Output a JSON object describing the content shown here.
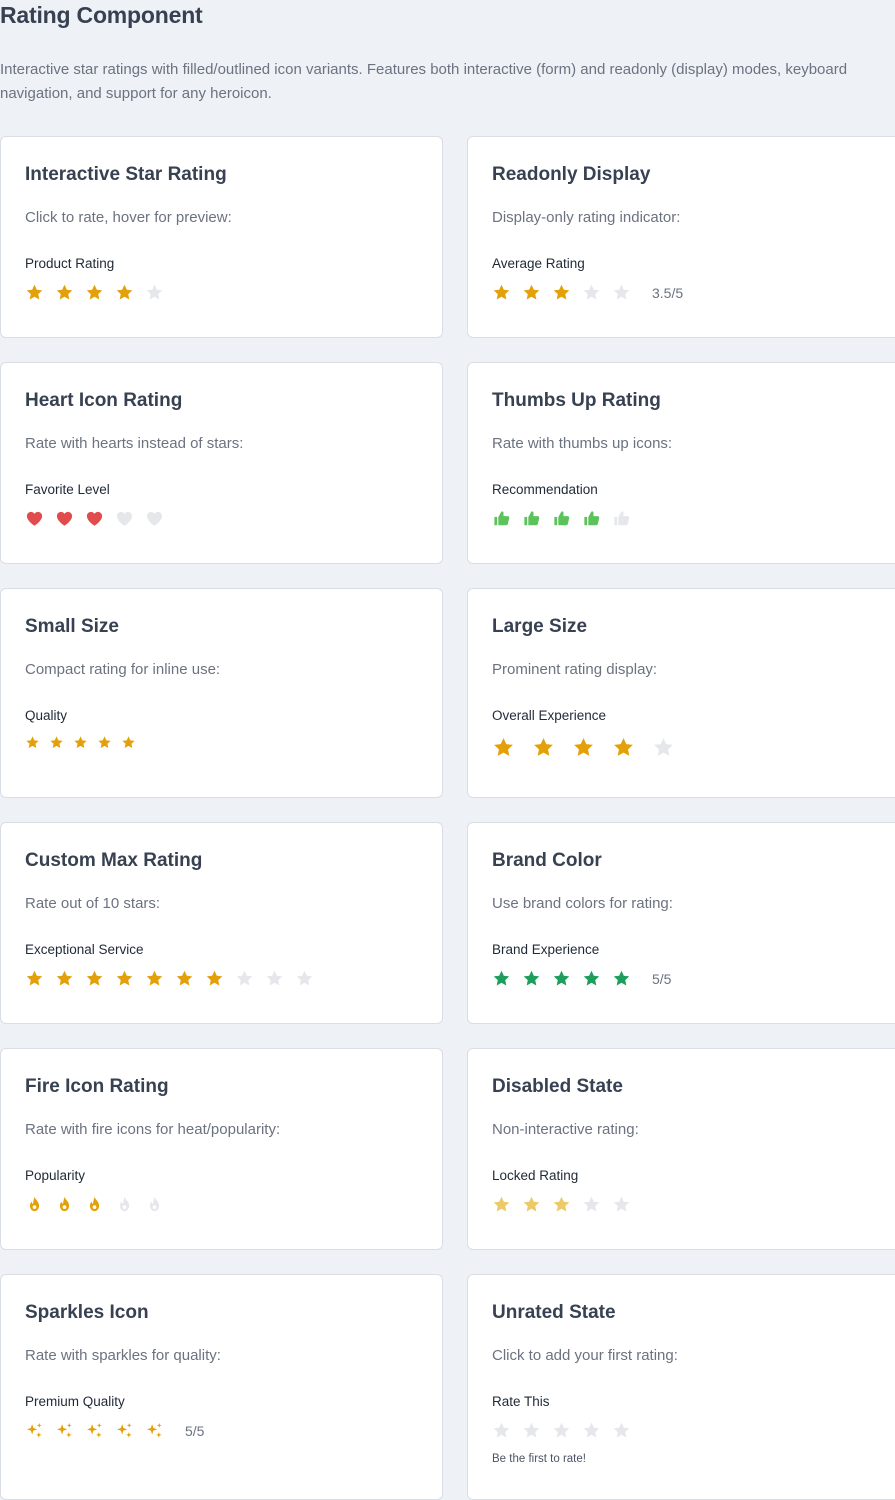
{
  "page": {
    "title": "Rating Component",
    "description": "Interactive star ratings with filled/outlined icon variants. Features both interactive (form) and readonly (display) modes, keyboard navigation, and support for any heroicon."
  },
  "colors": {
    "amber": "#e3a008",
    "amber_disabled": "#ecc96a",
    "empty": "#e5e7eb",
    "heart": "#e24b4b",
    "thumb": "#5cc25a",
    "brand": "#1e9e5c"
  },
  "cards": [
    {
      "title": "Interactive Star Rating",
      "description": "Click to rate, hover for preview:",
      "label": "Product Rating",
      "icon": "star-icon",
      "value": 4,
      "max": 5,
      "color": "amber",
      "size": "md"
    },
    {
      "title": "Readonly Display",
      "description": "Display-only rating indicator:",
      "label": "Average Rating",
      "icon": "star-icon",
      "value": 3,
      "max": 5,
      "color": "amber",
      "size": "md",
      "suffix": "3.5/5"
    },
    {
      "title": "Heart Icon Rating",
      "description": "Rate with hearts instead of stars:",
      "label": "Favorite Level",
      "icon": "heart-icon",
      "value": 3,
      "max": 5,
      "color": "heart",
      "size": "md"
    },
    {
      "title": "Thumbs Up Rating",
      "description": "Rate with thumbs up icons:",
      "label": "Recommendation",
      "icon": "thumb-up-icon",
      "value": 4,
      "max": 5,
      "color": "thumb",
      "size": "md"
    },
    {
      "title": "Small Size",
      "description": "Compact rating for inline use:",
      "label": "Quality",
      "icon": "star-icon",
      "value": 5,
      "max": 5,
      "color": "amber",
      "size": "sm"
    },
    {
      "title": "Large Size",
      "description": "Prominent rating display:",
      "label": "Overall Experience",
      "icon": "star-icon",
      "value": 4,
      "max": 5,
      "color": "amber",
      "size": "lg"
    },
    {
      "title": "Custom Max Rating",
      "description": "Rate out of 10 stars:",
      "label": "Exceptional Service",
      "icon": "star-icon",
      "value": 7,
      "max": 10,
      "color": "amber",
      "size": "md"
    },
    {
      "title": "Brand Color",
      "description": "Use brand colors for rating:",
      "label": "Brand Experience",
      "icon": "star-icon",
      "value": 5,
      "max": 5,
      "color": "brand",
      "size": "md",
      "suffix": "5/5"
    },
    {
      "title": "Fire Icon Rating",
      "description": "Rate with fire icons for heat/popularity:",
      "label": "Popularity",
      "icon": "fire-icon",
      "value": 3,
      "max": 5,
      "color": "amber",
      "size": "md"
    },
    {
      "title": "Disabled State",
      "description": "Non-interactive rating:",
      "label": "Locked Rating",
      "icon": "star-icon",
      "value": 3,
      "max": 5,
      "color": "amber_disabled",
      "size": "md",
      "disabled": true
    },
    {
      "title": "Sparkles Icon",
      "description": "Rate with sparkles for quality:",
      "label": "Premium Quality",
      "icon": "sparkles-icon",
      "value": 5,
      "max": 5,
      "color": "amber",
      "size": "md",
      "suffix": "5/5"
    },
    {
      "title": "Unrated State",
      "description": "Click to add your first rating:",
      "label": "Rate This",
      "icon": "star-icon",
      "value": 0,
      "max": 5,
      "color": "amber",
      "size": "md",
      "helper": "Be the first to rate!"
    }
  ]
}
